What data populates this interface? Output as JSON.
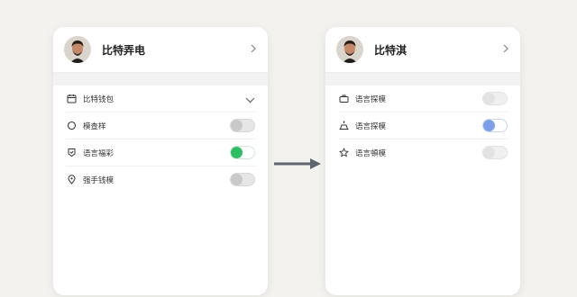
{
  "left_panel": {
    "profile_name": "比特弄电",
    "items": [
      {
        "label": "比特钱包",
        "icon": "calendar-icon",
        "control": "chevron-down"
      },
      {
        "label": "模查样",
        "icon": "circle-icon",
        "control": "toggle",
        "state": "off"
      },
      {
        "label": "语言福彩",
        "icon": "tag-icon",
        "control": "toggle",
        "state": "on"
      },
      {
        "label": "强手钱模",
        "icon": "location-pin-icon",
        "control": "toggle",
        "state": "off"
      }
    ]
  },
  "right_panel": {
    "profile_name": "比特淇",
    "items": [
      {
        "label": "语言探模",
        "icon": "briefcase-icon",
        "control": "toggle",
        "state": "off"
      },
      {
        "label": "语言探模",
        "icon": "robot-icon",
        "control": "toggle",
        "state": "on"
      },
      {
        "label": "语言頓模",
        "icon": "star-icon",
        "control": "toggle",
        "state": "off"
      }
    ]
  },
  "colors": {
    "background": "#f3f2ee",
    "toggle_on_green": "#2dbd63",
    "toggle_on_blue": "#7d9fe8",
    "arrow": "#5f6670"
  }
}
